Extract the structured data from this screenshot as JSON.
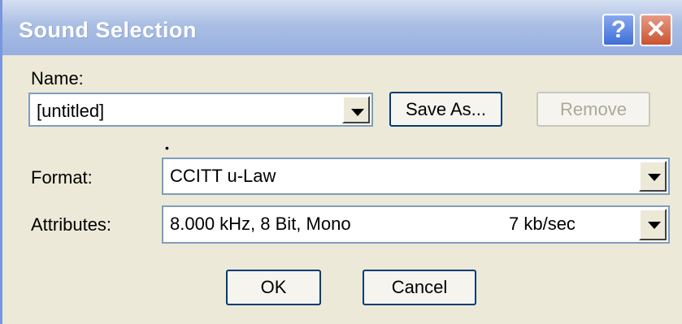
{
  "window": {
    "title": "Sound Selection",
    "help_glyph": "?",
    "close_glyph": "✕"
  },
  "name": {
    "label": "Name:",
    "value": "[untitled]",
    "save_as_label": "Save As...",
    "remove_label": "Remove"
  },
  "format": {
    "label": "Format:",
    "value": "CCITT u-Law"
  },
  "attributes": {
    "label": "Attributes:",
    "value": "8.000 kHz, 8 Bit, Mono",
    "rate": "7 kb/sec"
  },
  "buttons": {
    "ok_label": "OK",
    "cancel_label": "Cancel"
  },
  "colors": {
    "title_bar": "#97afdf",
    "dialog_bg": "#ece9d8",
    "close_button": "#c9532f",
    "help_button": "#3e6fd8"
  }
}
